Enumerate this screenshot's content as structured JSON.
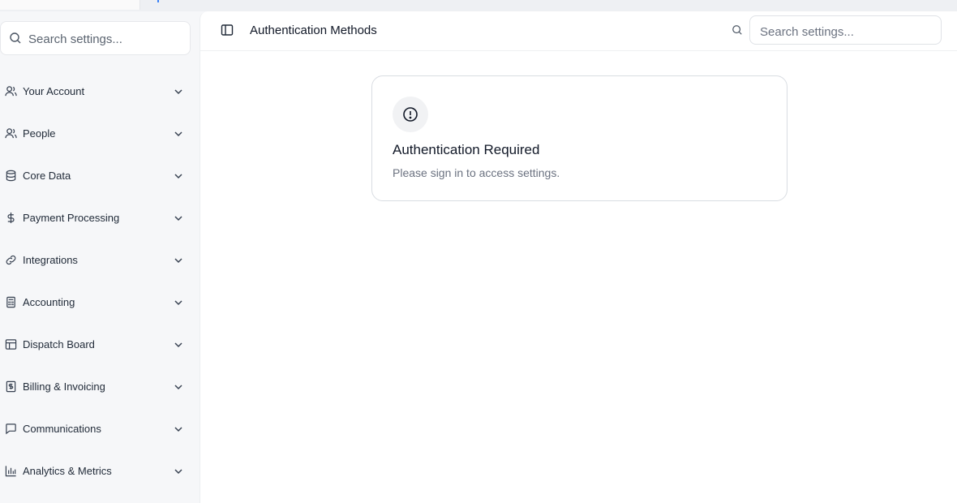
{
  "sidebar": {
    "search_placeholder": "Search settings...",
    "items": [
      {
        "label": "Your Account",
        "icon": "user-icon"
      },
      {
        "label": "People",
        "icon": "users-icon"
      },
      {
        "label": "Core Data",
        "icon": "database-icon"
      },
      {
        "label": "Payment Processing",
        "icon": "dollar-icon"
      },
      {
        "label": "Integrations",
        "icon": "link-icon"
      },
      {
        "label": "Accounting",
        "icon": "calculator-icon"
      },
      {
        "label": "Dispatch Board",
        "icon": "layout-board-icon"
      },
      {
        "label": "Billing & Invoicing",
        "icon": "receipt-icon"
      },
      {
        "label": "Communications",
        "icon": "message-square-icon"
      },
      {
        "label": "Analytics & Metrics",
        "icon": "bar-chart-icon"
      }
    ]
  },
  "header": {
    "title": "Authentication Methods",
    "search_placeholder": "Search settings..."
  },
  "notice": {
    "title": "Authentication Required",
    "message": "Please sign in to access settings.",
    "icon": "alert-circle-icon"
  },
  "colors": {
    "sidebar_bg": "#f6f7f9",
    "main_bg": "#ffffff",
    "border": "#d9dde2",
    "muted_text": "#6b7280"
  }
}
